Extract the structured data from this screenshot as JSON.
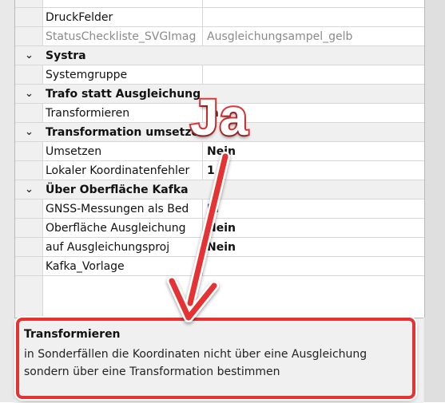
{
  "rows": [
    {
      "type": "prop",
      "key": "DruckFelder",
      "value": ""
    },
    {
      "type": "prop",
      "key": "StatusChecklisteSVGImage",
      "key_display": "StatusCheckliste_SVGImag",
      "value": "Ausgleichungsampel_gelb",
      "muted": true
    },
    {
      "type": "cat",
      "label": "Systra",
      "chevron": "⌄"
    },
    {
      "type": "prop",
      "key": "Systemgruppe",
      "value": ""
    },
    {
      "type": "cat",
      "label": "Trafo statt Ausgleichung",
      "chevron": "⌄"
    },
    {
      "type": "prop",
      "key": "Transformieren",
      "value": "Ja"
    },
    {
      "type": "cat",
      "label": "Transformation umsetzen",
      "chevron": "⌄"
    },
    {
      "type": "prop",
      "key": "Umsetzen",
      "value": "Nein"
    },
    {
      "type": "prop",
      "key": "Lokaler Koordinatenfehler",
      "value": "1"
    },
    {
      "type": "cat",
      "label": "Über Oberfläche Kafka",
      "chevron": "⌄"
    },
    {
      "type": "prop",
      "key": "GNSS-Messungen als Bed",
      "value": "Ja"
    },
    {
      "type": "prop",
      "key": "Oberfläche Ausgleichung",
      "value": "Nein"
    },
    {
      "type": "prop",
      "key": "auf Ausgleichungsproj",
      "value": "Nein"
    },
    {
      "type": "prop",
      "key": "Kafka_Vorlage",
      "value": ""
    }
  ],
  "description": {
    "title": "Transformieren",
    "text": "in Sonderfällen die Koordinaten nicht über eine Ausgleichung sondern über eine Transformation bestimmen"
  },
  "annotation": {
    "label": "Ja",
    "color": "#e53333"
  }
}
